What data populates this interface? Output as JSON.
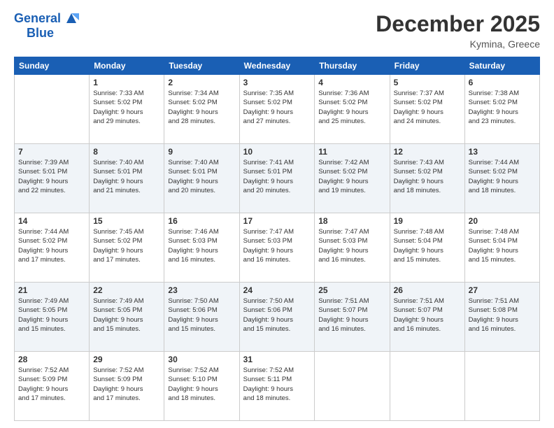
{
  "header": {
    "logo_general": "General",
    "logo_blue": "Blue",
    "month": "December 2025",
    "location": "Kymina, Greece"
  },
  "weekdays": [
    "Sunday",
    "Monday",
    "Tuesday",
    "Wednesday",
    "Thursday",
    "Friday",
    "Saturday"
  ],
  "weeks": [
    [
      {
        "day": "",
        "info": ""
      },
      {
        "day": "1",
        "info": "Sunrise: 7:33 AM\nSunset: 5:02 PM\nDaylight: 9 hours\nand 29 minutes."
      },
      {
        "day": "2",
        "info": "Sunrise: 7:34 AM\nSunset: 5:02 PM\nDaylight: 9 hours\nand 28 minutes."
      },
      {
        "day": "3",
        "info": "Sunrise: 7:35 AM\nSunset: 5:02 PM\nDaylight: 9 hours\nand 27 minutes."
      },
      {
        "day": "4",
        "info": "Sunrise: 7:36 AM\nSunset: 5:02 PM\nDaylight: 9 hours\nand 25 minutes."
      },
      {
        "day": "5",
        "info": "Sunrise: 7:37 AM\nSunset: 5:02 PM\nDaylight: 9 hours\nand 24 minutes."
      },
      {
        "day": "6",
        "info": "Sunrise: 7:38 AM\nSunset: 5:02 PM\nDaylight: 9 hours\nand 23 minutes."
      }
    ],
    [
      {
        "day": "7",
        "info": "Sunrise: 7:39 AM\nSunset: 5:01 PM\nDaylight: 9 hours\nand 22 minutes."
      },
      {
        "day": "8",
        "info": "Sunrise: 7:40 AM\nSunset: 5:01 PM\nDaylight: 9 hours\nand 21 minutes."
      },
      {
        "day": "9",
        "info": "Sunrise: 7:40 AM\nSunset: 5:01 PM\nDaylight: 9 hours\nand 20 minutes."
      },
      {
        "day": "10",
        "info": "Sunrise: 7:41 AM\nSunset: 5:01 PM\nDaylight: 9 hours\nand 20 minutes."
      },
      {
        "day": "11",
        "info": "Sunrise: 7:42 AM\nSunset: 5:02 PM\nDaylight: 9 hours\nand 19 minutes."
      },
      {
        "day": "12",
        "info": "Sunrise: 7:43 AM\nSunset: 5:02 PM\nDaylight: 9 hours\nand 18 minutes."
      },
      {
        "day": "13",
        "info": "Sunrise: 7:44 AM\nSunset: 5:02 PM\nDaylight: 9 hours\nand 18 minutes."
      }
    ],
    [
      {
        "day": "14",
        "info": "Sunrise: 7:44 AM\nSunset: 5:02 PM\nDaylight: 9 hours\nand 17 minutes."
      },
      {
        "day": "15",
        "info": "Sunrise: 7:45 AM\nSunset: 5:02 PM\nDaylight: 9 hours\nand 17 minutes."
      },
      {
        "day": "16",
        "info": "Sunrise: 7:46 AM\nSunset: 5:03 PM\nDaylight: 9 hours\nand 16 minutes."
      },
      {
        "day": "17",
        "info": "Sunrise: 7:47 AM\nSunset: 5:03 PM\nDaylight: 9 hours\nand 16 minutes."
      },
      {
        "day": "18",
        "info": "Sunrise: 7:47 AM\nSunset: 5:03 PM\nDaylight: 9 hours\nand 16 minutes."
      },
      {
        "day": "19",
        "info": "Sunrise: 7:48 AM\nSunset: 5:04 PM\nDaylight: 9 hours\nand 15 minutes."
      },
      {
        "day": "20",
        "info": "Sunrise: 7:48 AM\nSunset: 5:04 PM\nDaylight: 9 hours\nand 15 minutes."
      }
    ],
    [
      {
        "day": "21",
        "info": "Sunrise: 7:49 AM\nSunset: 5:05 PM\nDaylight: 9 hours\nand 15 minutes."
      },
      {
        "day": "22",
        "info": "Sunrise: 7:49 AM\nSunset: 5:05 PM\nDaylight: 9 hours\nand 15 minutes."
      },
      {
        "day": "23",
        "info": "Sunrise: 7:50 AM\nSunset: 5:06 PM\nDaylight: 9 hours\nand 15 minutes."
      },
      {
        "day": "24",
        "info": "Sunrise: 7:50 AM\nSunset: 5:06 PM\nDaylight: 9 hours\nand 15 minutes."
      },
      {
        "day": "25",
        "info": "Sunrise: 7:51 AM\nSunset: 5:07 PM\nDaylight: 9 hours\nand 16 minutes."
      },
      {
        "day": "26",
        "info": "Sunrise: 7:51 AM\nSunset: 5:07 PM\nDaylight: 9 hours\nand 16 minutes."
      },
      {
        "day": "27",
        "info": "Sunrise: 7:51 AM\nSunset: 5:08 PM\nDaylight: 9 hours\nand 16 minutes."
      }
    ],
    [
      {
        "day": "28",
        "info": "Sunrise: 7:52 AM\nSunset: 5:09 PM\nDaylight: 9 hours\nand 17 minutes."
      },
      {
        "day": "29",
        "info": "Sunrise: 7:52 AM\nSunset: 5:09 PM\nDaylight: 9 hours\nand 17 minutes."
      },
      {
        "day": "30",
        "info": "Sunrise: 7:52 AM\nSunset: 5:10 PM\nDaylight: 9 hours\nand 18 minutes."
      },
      {
        "day": "31",
        "info": "Sunrise: 7:52 AM\nSunset: 5:11 PM\nDaylight: 9 hours\nand 18 minutes."
      },
      {
        "day": "",
        "info": ""
      },
      {
        "day": "",
        "info": ""
      },
      {
        "day": "",
        "info": ""
      }
    ]
  ]
}
